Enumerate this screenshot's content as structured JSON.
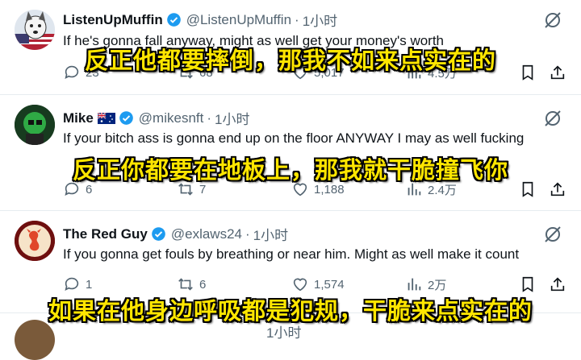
{
  "tweets": [
    {
      "name": "ListenUpMuffin",
      "handle": "@ListenUpMuffin",
      "time": "1小时",
      "text": "If he's gonna fall anyway, might as well get your money's worth",
      "replies": "23",
      "retweets": "68",
      "likes": "5,017",
      "views": "4.5万",
      "subtitle": "反正他都要摔倒，那我不如来点实在的"
    },
    {
      "name": "Mike",
      "handle": "@mikesnft",
      "time": "1小时",
      "text": "If your bitch ass is gonna end up on the floor ANYWAY I may as well fucking",
      "replies": "6",
      "retweets": "7",
      "likes": "1,188",
      "views": "2.4万",
      "subtitle": "反正你都要在地板上，那我就干脆撞飞你"
    },
    {
      "name": "The Red Guy",
      "handle": "@exlaws24",
      "time": "1小时",
      "text": "If you gonna get fouls by breathing or near him. Might as well make it count",
      "replies": "1",
      "retweets": "6",
      "likes": "1,574",
      "views": "2万",
      "subtitle": "如果在他身边呼吸都是犯规，干脆来点实在的"
    },
    {
      "time": "1小时"
    }
  ],
  "colors": {
    "verified": "#1d9bf0",
    "subtitle": "#ffe600",
    "muted": "#536471"
  }
}
